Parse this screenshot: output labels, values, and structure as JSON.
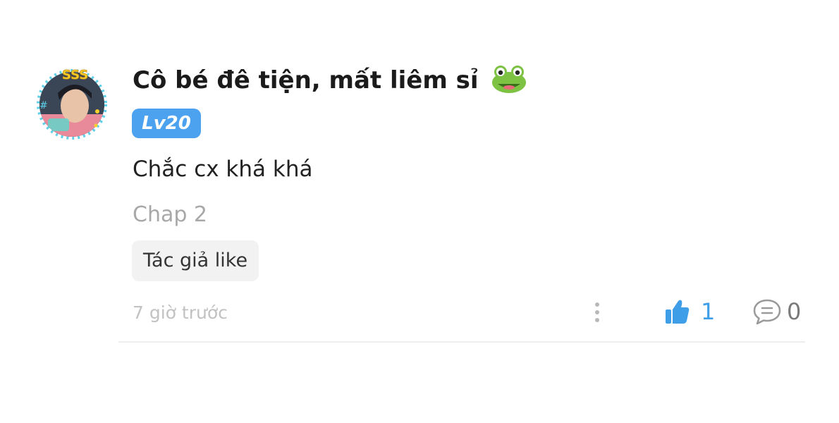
{
  "comment": {
    "username": "Cô bé đê tiện, mất liêm sỉ",
    "username_emoji": "frog-face-icon",
    "level": "Lv20",
    "text": "Chắc cx khá khá",
    "chapter": "Chap 2",
    "author_badge": "Tác giả like",
    "timestamp": "7 giờ trước",
    "likes": "1",
    "replies": "0"
  },
  "colors": {
    "level_badge": "#4da2ef",
    "like_accent": "#3f9ee8",
    "muted_text": "#a8a8a8",
    "badge_bg": "#f2f2f2"
  }
}
